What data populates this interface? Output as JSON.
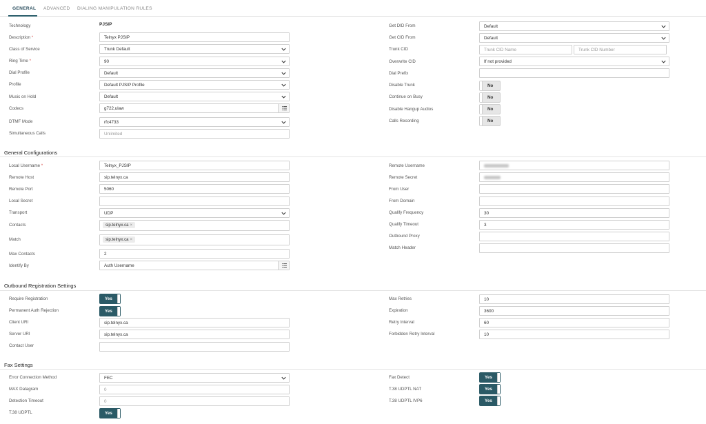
{
  "tabs": [
    "GENERAL",
    "ADVANCED",
    "DIALING MANIPULATION RULES"
  ],
  "general": {
    "technology_label": "Technology",
    "technology_value": "PJSIP",
    "description_label": "Description",
    "description_value": "Telnyx PJSIP",
    "class_of_service_label": "Class of Service",
    "class_of_service_value": "Trunk Default",
    "ring_time_label": "Ring Time",
    "ring_time_value": "90",
    "dial_profile_label": "Dial Profile",
    "dial_profile_value": "Default",
    "profile_label": "Profile",
    "profile_value": "Default PJSIP Profile",
    "music_on_hold_label": "Music on Hold",
    "music_on_hold_value": "Default",
    "codecs_label": "Codecs",
    "codecs_value": "g722,ulaw",
    "dtmf_mode_label": "DTMF Mode",
    "dtmf_mode_value": "rfc4733",
    "simultaneous_calls_label": "Simultaneous Calls",
    "simultaneous_calls_placeholder": "Unlimited",
    "get_did_from_label": "Get DID From",
    "get_did_from_value": "Default",
    "get_cid_from_label": "Get CID From",
    "get_cid_from_value": "Default",
    "trunk_cid_label": "Trunk CID",
    "trunk_cid_name_placeholder": "Trunk CID Name",
    "trunk_cid_number_placeholder": "Trunk CID Number",
    "overwrite_cid_label": "Overwrite CID",
    "overwrite_cid_value": "If not provided",
    "dial_prefix_label": "Dial Prefix",
    "disable_trunk_label": "Disable Trunk",
    "disable_trunk_value": "No",
    "continue_on_busy_label": "Continue on Busy",
    "continue_on_busy_value": "No",
    "disable_hangup_audios_label": "Disable Hangup Audios",
    "disable_hangup_audios_value": "No",
    "calls_recording_label": "Calls Recording",
    "calls_recording_value": "No"
  },
  "general_config": {
    "title": "General Configurations",
    "local_username_label": "Local Username",
    "local_username_value": "Telnyx_PJSIP",
    "remote_host_label": "Remote Host",
    "remote_host_value": "sip.telnyx.ca",
    "remote_port_label": "Remote Port",
    "remote_port_value": "5060",
    "local_secret_label": "Local Secret",
    "transport_label": "Transport",
    "transport_value": "UDP",
    "contacts_label": "Contacts",
    "contacts_chip": "sip.telnyx.ca",
    "match_label": "Match",
    "match_chip": "sip.telnyx.ca",
    "max_contacts_label": "Max Contacts",
    "max_contacts_value": "2",
    "identify_by_label": "Identify By",
    "identify_by_value": "Auth Username",
    "remote_username_label": "Remote Username",
    "remote_secret_label": "Remote Secret",
    "from_user_label": "From User",
    "from_domain_label": "From Domain",
    "qualify_frequency_label": "Qualify Frequency",
    "qualify_frequency_value": "30",
    "qualify_timeout_label": "Qualify Timeout",
    "qualify_timeout_value": "3",
    "outbound_proxy_label": "Outbound Proxy",
    "match_header_label": "Match Header"
  },
  "outbound_reg": {
    "title": "Outbound Registration Settings",
    "require_registration_label": "Require Registration",
    "require_registration_value": "Yes",
    "permanent_auth_rejection_label": "Permanent Auth Rejection",
    "permanent_auth_rejection_value": "Yes",
    "client_uri_label": "Client URI",
    "client_uri_value": "sip.telnyx.ca",
    "server_uri_label": "Server URI",
    "server_uri_value": "sip.telnyx.ca",
    "contact_user_label": "Contact User",
    "max_retries_label": "Max Retries",
    "max_retries_value": "10",
    "expiration_label": "Expiration",
    "expiration_value": "3600",
    "retry_interval_label": "Retry Interval",
    "retry_interval_value": "60",
    "forbidden_retry_interval_label": "Forbidden Retry Interval",
    "forbidden_retry_interval_value": "10"
  },
  "fax": {
    "title": "Fax Settings",
    "error_correction_method_label": "Error Connection Method",
    "error_correction_method_value": "FEC",
    "max_datagram_label": "MAX Datagram",
    "max_datagram_placeholder": "0",
    "detection_timeout_label": "Detection Timeout",
    "detection_timeout_placeholder": "0",
    "t38_udptl_label": "T.38 UDPTL",
    "t38_udptl_value": "Yes",
    "fax_detect_label": "Fax Detect",
    "fax_detect_value": "Yes",
    "t38_udptl_nat_label": "T.38 UDPTL NAT",
    "t38_udptl_nat_value": "Yes",
    "t38_udptl_ipv6_label": "T.38 UDPTL IVP6",
    "t38_udptl_ipv6_value": "Yes"
  },
  "colors": {
    "accent": "#2b5a66",
    "required": "#d9534f"
  }
}
